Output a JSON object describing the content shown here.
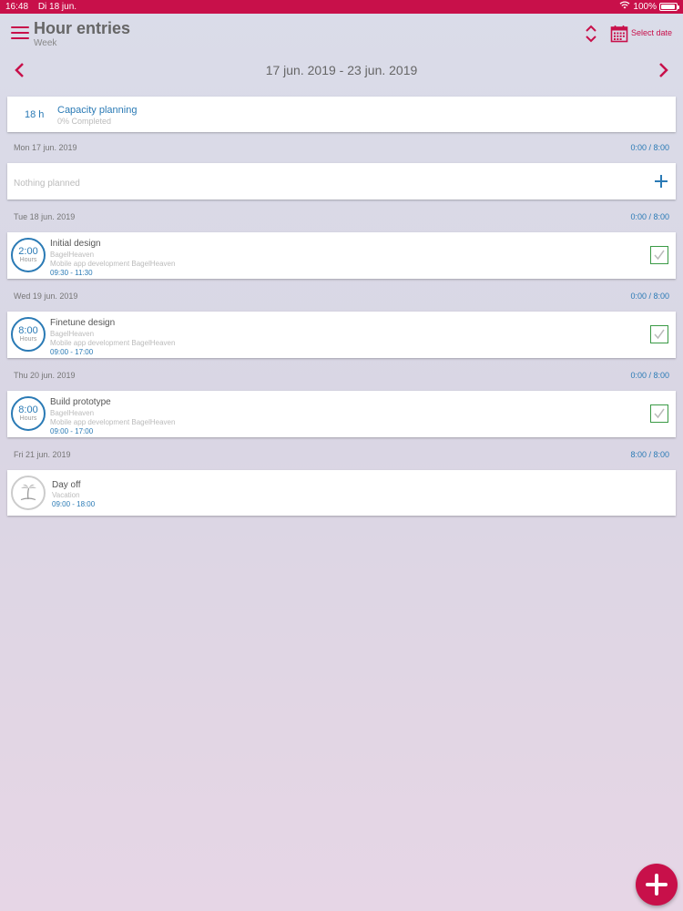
{
  "status_bar": {
    "time": "16:48",
    "date": "Di 18 jun.",
    "battery": "100%",
    "battery_level": 1.0
  },
  "header": {
    "title": "Hour entries",
    "subtitle": "Week",
    "select_date_label": "Select date"
  },
  "week_nav": {
    "range": "17 jun. 2019 - 23 jun. 2019"
  },
  "capacity": {
    "hours": "18 h",
    "title": "Capacity planning",
    "subtitle": "0% Completed"
  },
  "days": [
    {
      "date": "Mon 17 jun. 2019",
      "total": "0:00 / 8:00",
      "empty_text": "Nothing planned"
    },
    {
      "date": "Tue 18 jun. 2019",
      "total": "0:00 / 8:00",
      "entry": {
        "duration": "2:00",
        "unit": "Hours",
        "title": "Initial design",
        "client": "BagelHeaven",
        "project": "Mobile app development BagelHeaven",
        "time": "09:30 - 11:30"
      }
    },
    {
      "date": "Wed 19 jun. 2019",
      "total": "0:00 / 8:00",
      "entry": {
        "duration": "8:00",
        "unit": "Hours",
        "title": "Finetune design",
        "client": "BagelHeaven",
        "project": "Mobile app development BagelHeaven",
        "time": "09:00 - 17:00"
      }
    },
    {
      "date": "Thu 20 jun. 2019",
      "total": "0:00 / 8:00",
      "entry": {
        "duration": "8:00",
        "unit": "Hours",
        "title": "Build prototype",
        "client": "BagelHeaven",
        "project": "Mobile app development BagelHeaven",
        "time": "09:00 - 17:00"
      }
    },
    {
      "date": "Fri 21 jun. 2019",
      "total": "8:00 / 8:00",
      "dayoff": {
        "title": "Day off",
        "subtitle": "Vacation",
        "time": "09:00 - 18:00"
      }
    }
  ],
  "icons": {
    "menu": "hamburger-menu-icon",
    "sort": "sort-up-down-icon",
    "calendar": "calendar-icon",
    "prev": "chevron-left-icon",
    "next": "chevron-right-icon",
    "add": "plus-icon",
    "check": "checkbox-checked-icon",
    "vacation": "palm-tree-icon"
  },
  "colors": {
    "accent": "#c8104a",
    "link": "#2a7ab5",
    "approved": "#3a9a45"
  }
}
